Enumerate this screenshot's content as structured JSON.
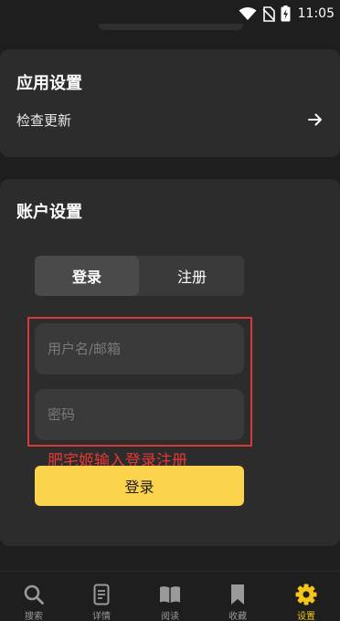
{
  "status_bar": {
    "time": "11:05",
    "icons": [
      "wifi-icon",
      "no-sim-icon",
      "battery-charging-icon"
    ]
  },
  "app_settings": {
    "title": "应用设置",
    "check_update_label": "检查更新",
    "arrow_icon": "arrow-right-icon"
  },
  "account_settings": {
    "title": "账户设置",
    "tabs": [
      {
        "label": "登录",
        "active": true
      },
      {
        "label": "注册",
        "active": false
      }
    ],
    "username_placeholder": "用户名/邮箱",
    "username_value": "",
    "password_placeholder": "密码",
    "password_value": "",
    "annotation": "肥宅姬输入登录注册",
    "submit_label": "登录"
  },
  "bottom_nav": {
    "items": [
      {
        "label": "搜索",
        "icon": "search-icon",
        "active": false
      },
      {
        "label": "详情",
        "icon": "document-icon",
        "active": false
      },
      {
        "label": "阅读",
        "icon": "book-open-icon",
        "active": false
      },
      {
        "label": "收藏",
        "icon": "bookmark-icon",
        "active": false
      },
      {
        "label": "设置",
        "icon": "gear-icon",
        "active": true
      }
    ]
  },
  "colors": {
    "background": "#1e1e1e",
    "card": "#2c2c2c",
    "accent": "#f5c518",
    "button": "#fcd34d",
    "annotation": "#e53935"
  }
}
